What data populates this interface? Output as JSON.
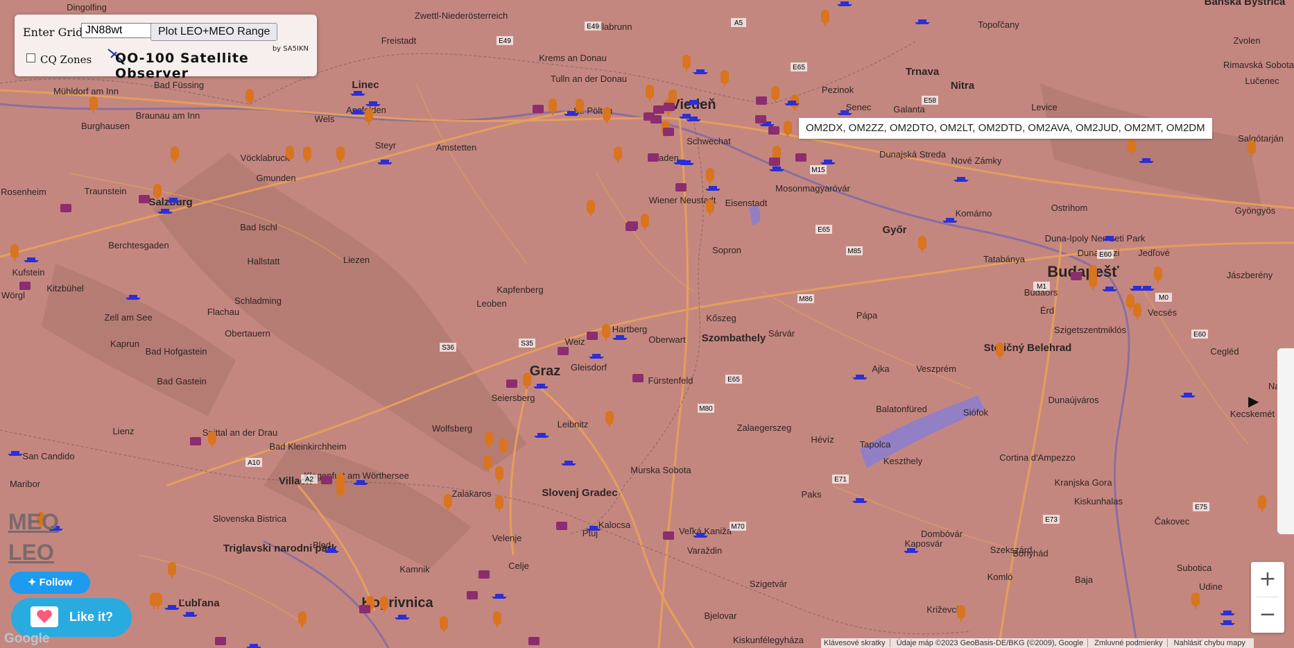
{
  "controls": {
    "grid_label": "Enter Grid:",
    "grid_value": "JN88wt",
    "plot_button": "Plot LEO+MEO Range",
    "cq_zones_label": "CQ Zones",
    "cq_zones_checked": false,
    "app_title": "QO-100 Satellite Observer",
    "byline": "by SA5IKN"
  },
  "tooltip": "OM2DX, OM2ZZ, OM2DTO, OM2LT, OM2DTD, OM2AVA, OM2JUD, OM2MT, OM2DM",
  "overlay_labels": {
    "meo": "MEO",
    "leo": "LEO"
  },
  "social": {
    "follow": "Follow",
    "like": "Like it?"
  },
  "zoom": {
    "in": "+",
    "out": "−"
  },
  "attribution": [
    "Klávesové skratky",
    "Údaje máp ©2023 GeoBasis-DE/BKG (©2009), Google",
    "Zmluvné podmienky",
    "Nahlásiť chybu mapy"
  ],
  "google_logo": "Google",
  "colors": {
    "overlay": "#c98d87",
    "road": "#e8a25a",
    "water": "#8a7ed0",
    "marker_orange": "#d9741f",
    "marker_blue": "#2b2fd6",
    "marker_purple": "#8b2d6e"
  },
  "places": [
    "Dingolfing",
    "Zwettl-Niederösterreich",
    "Banská Bystrica",
    "Freistadt",
    "Hollabrunn",
    "Topoľčany",
    "Zvolen",
    "Krems an Donau",
    "Tulln an der Donau",
    "Trnava",
    "Nitra",
    "Rimavská Sobota",
    "Mühldorf am Inn",
    "Bad Füssing",
    "Linec",
    "Pezinok",
    "Lučenec",
    "Braunau am Inn",
    "Burghausen",
    "Wels",
    "Ansfelden",
    "Viedeň",
    "Senec",
    "Levice",
    "Amstetten",
    "St. Pölten",
    "Schwechat",
    "Galanta",
    "Salgótarján",
    "Vöcklabruck",
    "Steyr",
    "Baden",
    "Dunajská Streda",
    "Nové Zámky",
    "Gmunden",
    "Traunstein",
    "Rosenheim",
    "Salzburg",
    "Wiener Neustadt",
    "Eisenstadt",
    "Mosonmagyaróvár",
    "Komárno",
    "Ostrihom",
    "Gyöngyös",
    "Bad Ischl",
    "Berchtesgaden",
    "Győr",
    "Duna-Ipoly Nemzeti Park",
    "Kufstein",
    "Hallstatt",
    "Liezen",
    "Sopron",
    "Tatabánya",
    "Dunakeszi",
    "Jedľové",
    "Kitzbühel",
    "Wörgl",
    "Kapfenberg",
    "Budapešť",
    "Schladming",
    "Leoben",
    "Budaörs",
    "Vecsés",
    "Jászberény",
    "Zell am See",
    "Flachau",
    "Kőszeg",
    "Pápa",
    "Érd",
    "Szigetszentmiklós",
    "Obertauern",
    "Hartberg",
    "Oberwart",
    "Szombathely",
    "Sárvár",
    "Kaprun",
    "Bad Hofgastein",
    "Weiz",
    "Stoličný Belehrad",
    "Cegléd",
    "Gleisdorf",
    "Graz",
    "Ajka",
    "Veszprém",
    "Bad Gastein",
    "Fürstenfeld",
    "Nagykőrös",
    "Seiersberg",
    "Balatonfüred",
    "Siófok",
    "Dunaújváros",
    "Kecskemét",
    "Lienz",
    "Wolfsberg",
    "Zalaegerszeg",
    "Spittal an der Drau",
    "Bad Kleinkirchheim",
    "Leibnitz",
    "Hévíz",
    "Tapolca",
    "San Candido",
    "Klagenfurt am Wörthersee",
    "Keszthely",
    "Villach",
    "Murska Sobota",
    "Cortina d'Ampezzo",
    "Maribor",
    "Slovenj Gradec",
    "Zalakaros",
    "Paks",
    "Kranjska Gora",
    "Slovenska Bistrica",
    "Ptuj",
    "Kalocsa",
    "Kiskunhalas",
    "Čakovec",
    "Veľká Kaniža",
    "Triglavski narodni park",
    "Bled",
    "Velenje",
    "Varaždin",
    "Kaposvár",
    "Dombóvár",
    "Szekszárd",
    "Bonyhád",
    "Kamnik",
    "Celje",
    "Komló",
    "Baja",
    "Subotica",
    "Udine",
    "Ľubľana",
    "Koprivnica",
    "Szigetvár",
    "Križevci",
    "Bjelovar",
    "Kiskunfélegyháza"
  ]
}
